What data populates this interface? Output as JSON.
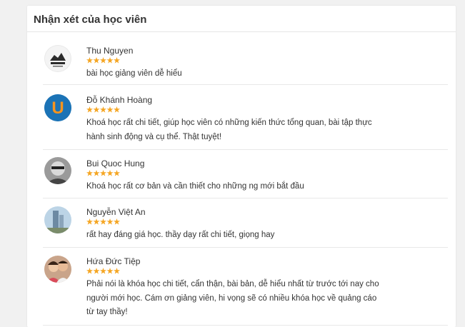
{
  "section": {
    "title": "Nhận xét của học viên"
  },
  "star_color": "#f5a623",
  "reviews": [
    {
      "name": "Thu Nguyen",
      "rating": 5,
      "comment": "bài học giảng viên dễ hiểu",
      "avatar": "school-logo-avatar"
    },
    {
      "name": "Đỗ Khánh Hoàng",
      "rating": 5,
      "comment": "Khoá học rất chi tiết, giúp học viên có những kiến thức tổng quan, bài tập thực hành sinh động và cụ thể. Thật tuyệt!",
      "avatar": "letter-u-avatar",
      "avatar_letter": "U"
    },
    {
      "name": "Bui Quoc Hung",
      "rating": 5,
      "comment": "Khoá học rất cơ bản và cần thiết cho những ng mới bắt đầu",
      "avatar": "person-photo-avatar"
    },
    {
      "name": "Nguyễn Việt An",
      "rating": 5,
      "comment": "rất hay đáng giá học. thầy dạy rất chi tiết, giọng hay",
      "avatar": "building-photo-avatar"
    },
    {
      "name": "Hứa Đức Tiệp",
      "rating": 5,
      "comment": "Phải nói là khóa học chi tiết, cẩn thận, bài bản, dễ hiểu nhất từ trước tới nay cho người mới học. Cám ơn giảng viên, hi vọng sẽ có nhiều khóa học về quảng cáo từ tay thầy!",
      "avatar": "couple-photo-avatar"
    }
  ]
}
